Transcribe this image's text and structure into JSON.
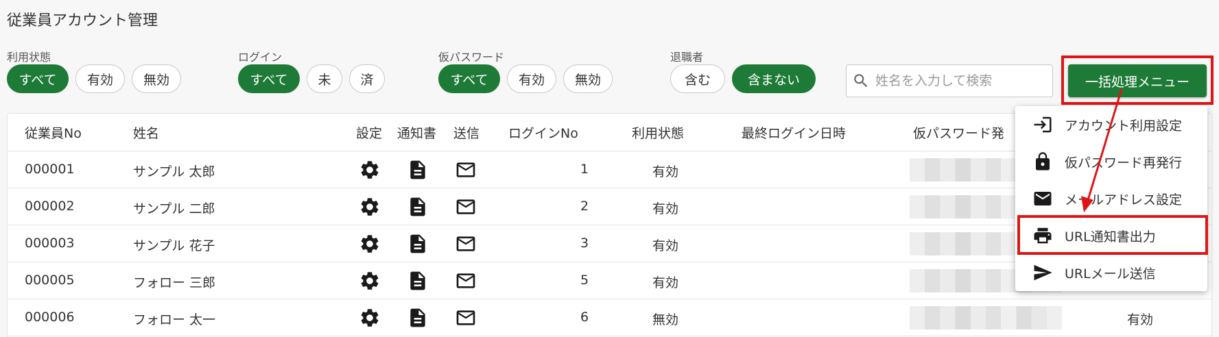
{
  "page_title": "従業員アカウント管理",
  "filters": {
    "usage": {
      "label": "利用状態",
      "options": [
        "すべて",
        "有効",
        "無効"
      ],
      "selected": "すべて"
    },
    "login": {
      "label": "ログイン",
      "options": [
        "すべて",
        "未",
        "済"
      ],
      "selected": "すべて"
    },
    "temp_password": {
      "label": "仮パスワード",
      "options": [
        "すべて",
        "有効",
        "無効"
      ],
      "selected": "すべて"
    },
    "retired": {
      "label": "退職者",
      "options": [
        "含む",
        "含まない"
      ],
      "selected": "含まない"
    }
  },
  "search": {
    "placeholder": "姓名を入力して検索"
  },
  "bulk_menu_label": "一括処理メニュー",
  "table": {
    "headers": [
      "従業員No",
      "姓名",
      "設定",
      "通知書",
      "送信",
      "ログインNo",
      "利用状態",
      "最終ログイン日時",
      "仮パスワード発"
    ],
    "rows": [
      {
        "no": "000001",
        "name": "サンプル 太郎",
        "login_no": "1",
        "status": "有効",
        "last_status": ""
      },
      {
        "no": "000002",
        "name": "サンプル 二郎",
        "login_no": "2",
        "status": "有効",
        "last_status": ""
      },
      {
        "no": "000003",
        "name": "サンプル 花子",
        "login_no": "3",
        "status": "有効",
        "last_status": ""
      },
      {
        "no": "000005",
        "name": "フォロー 三郎",
        "login_no": "5",
        "status": "有効",
        "last_status": ""
      },
      {
        "no": "000006",
        "name": "フォロー 太一",
        "login_no": "6",
        "status": "無効",
        "last_status": "有効"
      }
    ]
  },
  "dropdown_menu": {
    "items": [
      {
        "label": "アカウント利用設定",
        "icon": "login-icon"
      },
      {
        "label": "仮パスワード再発行",
        "icon": "lock-icon"
      },
      {
        "label": "メールアドレス設定",
        "icon": "mail-icon"
      },
      {
        "label": "URL通知書出力",
        "icon": "print-icon"
      },
      {
        "label": "URLメール送信",
        "icon": "send-icon"
      }
    ]
  },
  "colors": {
    "accent": "#1e7b37",
    "highlight": "#e01414"
  }
}
